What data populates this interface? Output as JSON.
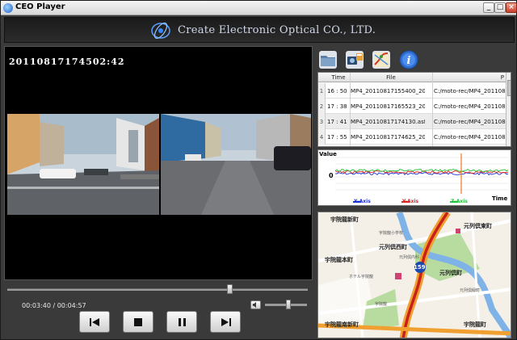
{
  "window": {
    "title": "CEO Player",
    "min_label": "_",
    "max_label": "□",
    "close_label": "×"
  },
  "banner": {
    "company": "Create Electronic Optical CO., LTD."
  },
  "video": {
    "timestamp": "20110817174502:42"
  },
  "playback": {
    "time_readout": "00:03:40 / 00:04:57",
    "seek_fraction": 0.74,
    "volume_fraction": 0.55
  },
  "toolbar": {
    "icons": [
      "folder-icon",
      "camera-settings-icon",
      "map-icon",
      "info-icon"
    ]
  },
  "file_table": {
    "headers": [
      "",
      "Time",
      "File",
      "P"
    ],
    "rows": [
      {
        "idx": "1",
        "time": "16 : 50",
        "file": "MP4_20110817155400_201108···",
        "path": "C:/moto-rec/MP4_20110817"
      },
      {
        "idx": "2",
        "time": "17 : 38",
        "file": "MP4_20110817165523_201108···",
        "path": "C:/moto-rec/MP4_20110817"
      },
      {
        "idx": "3",
        "time": "17 : 41",
        "file": "MP4_20110817174130.asf",
        "path": "C:/moto-rec/MP4_20110817"
      },
      {
        "idx": "4",
        "time": "17 : 55",
        "file": "MP4_20110817174625_201108···",
        "path": "C:/moto-rec/MP4_20110817"
      }
    ],
    "selected_index": 2
  },
  "graph": {
    "title": "Value",
    "zero_label": "0",
    "time_label": "Time",
    "legend": [
      {
        "label": "X-Axis",
        "color": "#1a2fd6"
      },
      {
        "label": "Y-Axis",
        "color": "#e0221e"
      },
      {
        "label": "Z-Axis",
        "color": "#22c23a"
      }
    ],
    "marker_color": "#f07a20"
  },
  "map": {
    "labels": [
      {
        "text": "宇院龍新町",
        "cls": ""
      },
      {
        "text": "元列倶東町",
        "cls": ""
      },
      {
        "text": "元列倶西町",
        "cls": ""
      },
      {
        "text": "宇院龍本町",
        "cls": ""
      },
      {
        "text": "元列倶町",
        "cls": ""
      },
      {
        "text": "宇院龍南新町",
        "cls": ""
      },
      {
        "text": "宇院龍町",
        "cls": ""
      },
      {
        "text": "宇院龍小学校",
        "cls": "small"
      },
      {
        "text": "元列倶内科",
        "cls": "small"
      },
      {
        "text": "宇院龍",
        "cls": "small"
      },
      {
        "text": "ホテル宇院龍",
        "cls": "small"
      },
      {
        "text": "元列倶緑町",
        "cls": "small"
      }
    ],
    "route_badge": "159"
  }
}
